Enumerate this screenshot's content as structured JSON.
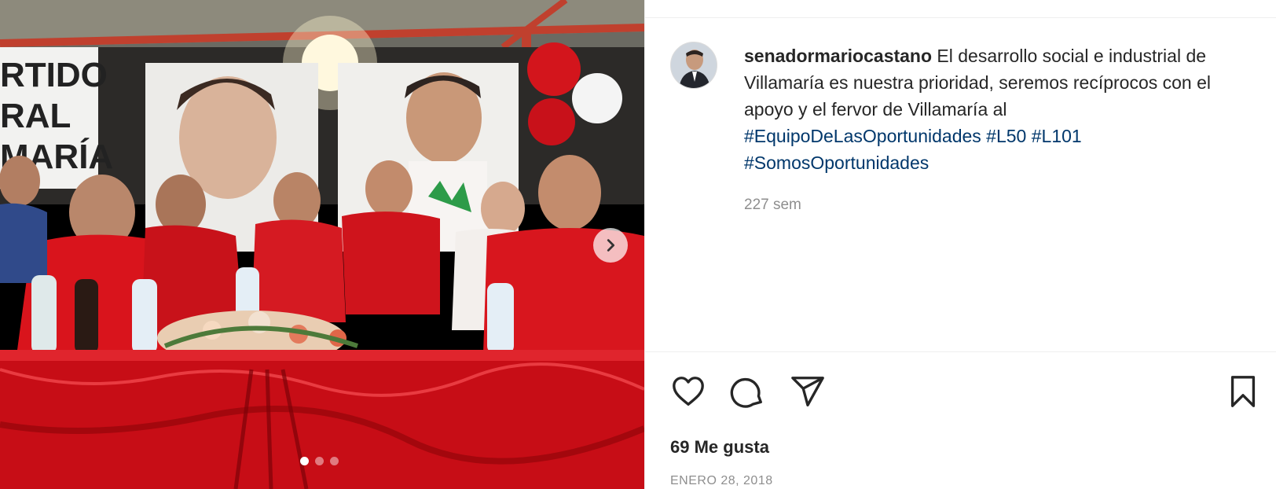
{
  "post": {
    "username": "senadormariocastano",
    "caption_text": "El desarrollo social e industrial de Villamaría es nuestra prioridad, seremos recíprocos con el apoyo y el fervor de Villamaría al",
    "hashtags": [
      "#EquipoDeLasOportunidades",
      "#L50",
      "#L101",
      "#SomosOportunidades"
    ],
    "time_ago": "227 sem",
    "likes": "69 Me gusta",
    "date": "ENERO 28, 2018"
  },
  "media": {
    "slide_count": 3,
    "active_slide": 1,
    "banner_text": [
      "RTIDO",
      "RAL",
      "MARÍA"
    ],
    "next_icon": "chevron-right-icon"
  },
  "icons": {
    "like": "heart-icon",
    "comment": "comment-icon",
    "share": "paper-plane-icon",
    "save": "bookmark-icon"
  },
  "colors": {
    "hashtag": "#00376b",
    "secondary_text": "#8e8e8e",
    "primary_text": "#262626"
  }
}
